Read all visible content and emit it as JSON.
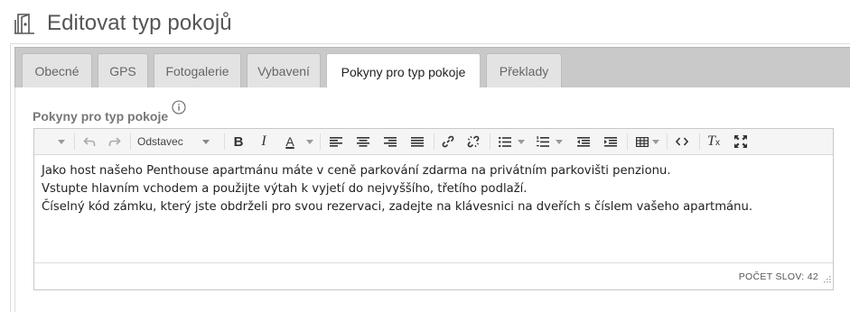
{
  "header": {
    "title": "Editovat typ pokojů",
    "icon": "door-icon"
  },
  "tabs": [
    {
      "label": "Obecné",
      "active": false
    },
    {
      "label": "GPS",
      "active": false
    },
    {
      "label": "Fotogalerie",
      "active": false
    },
    {
      "label": "Vybavení",
      "active": false
    },
    {
      "label": "Pokyny pro typ pokoje",
      "active": true
    },
    {
      "label": "Překlady",
      "active": false
    }
  ],
  "field": {
    "label": "Pokyny pro typ pokoje",
    "info_icon": "info-icon"
  },
  "editor": {
    "format_select": "Odstavec",
    "lines": [
      "Jako host našeho Penthouse apartmánu máte v ceně parkování zdarma na privátním parkovišti penzionu.",
      "Vstupte hlavním vchodem a použijte výtah k vyjetí do nejvyššího, třetího podlaží.",
      "Číselný kód zámku, který jste obdrželi pro svou rezervaci, zadejte na klávesnici na dveřích s číslem vašeho apartmánu."
    ],
    "word_count": "POČET SLOV: 42"
  },
  "colors": {
    "tabbar": "#c9c9c9",
    "tab": "#e3e3e3",
    "toolbar": "#f5f5f5",
    "text": "#222222"
  }
}
